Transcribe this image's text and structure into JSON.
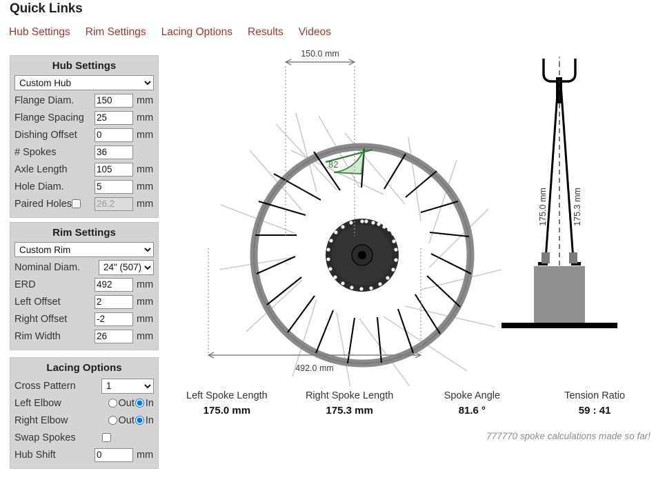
{
  "header": {
    "title": "Quick Links",
    "nav": [
      {
        "label": "Hub Settings"
      },
      {
        "label": "Rim Settings"
      },
      {
        "label": "Lacing Options"
      },
      {
        "label": "Results"
      },
      {
        "label": "Videos"
      }
    ],
    "link_color": "#a0352f"
  },
  "hub_settings": {
    "title": "Hub Settings",
    "preset": "Custom Hub",
    "fields": [
      {
        "label": "Flange Diam.",
        "value": "150",
        "unit": "mm"
      },
      {
        "label": "Flange Spacing",
        "value": "25",
        "unit": "mm"
      },
      {
        "label": "Dishing Offset",
        "value": "0",
        "unit": "mm"
      },
      {
        "label": "# Spokes",
        "value": "36",
        "unit": ""
      },
      {
        "label": "Axle Length",
        "value": "105",
        "unit": "mm"
      },
      {
        "label": "Hole Diam.",
        "value": "5",
        "unit": "mm"
      }
    ],
    "paired_holes": {
      "label": "Paired Holes",
      "checked": false,
      "value": "26.2",
      "unit": "mm"
    }
  },
  "rim_settings": {
    "title": "Rim Settings",
    "preset": "Custom Rim",
    "nominal_diam": {
      "label": "Nominal Diam.",
      "value": "24\" (507)"
    },
    "fields": [
      {
        "label": "ERD",
        "value": "492",
        "unit": "mm"
      },
      {
        "label": "Left Offset",
        "value": "2",
        "unit": "mm"
      },
      {
        "label": "Right Offset",
        "value": "-2",
        "unit": "mm"
      },
      {
        "label": "Rim Width",
        "value": "26",
        "unit": "mm"
      }
    ]
  },
  "lacing_options": {
    "title": "Lacing Options",
    "cross_pattern": {
      "label": "Cross Pattern",
      "value": "1"
    },
    "left_elbow": {
      "label": "Left Elbow",
      "out": "Out",
      "in": "In",
      "selected": "In"
    },
    "right_elbow": {
      "label": "Right Elbow",
      "out": "Out",
      "in": "In",
      "selected": "In"
    },
    "swap_spokes": {
      "label": "Swap Spokes",
      "checked": false
    },
    "hub_shift": {
      "label": "Hub Shift",
      "value": "0",
      "unit": "mm"
    }
  },
  "diagram": {
    "flange_spacing_dim": "150.0 mm",
    "erd_dim": "492.0 mm",
    "spoke_angle_badge": "82",
    "left_spoke_dim": "175.0 mm",
    "right_spoke_dim": "175.3 mm",
    "colors": {
      "rim": "#808080",
      "hub": "#2b2b2b",
      "near_spoke": "#000000",
      "far_spoke": "#cccccc",
      "dim_line": "#7d7d7d",
      "angle_fill": "#cfe8cf",
      "angle_stroke": "#2e7d32"
    }
  },
  "results": [
    {
      "label": "Left Spoke Length",
      "value": "175.0 mm"
    },
    {
      "label": "Right Spoke Length",
      "value": "175.3 mm"
    },
    {
      "label": "Spoke Angle",
      "value": "81.6 °"
    },
    {
      "label": "Tension Ratio",
      "value": "59 : 41"
    }
  ],
  "counter": "777770 spoke calculations made so far!"
}
